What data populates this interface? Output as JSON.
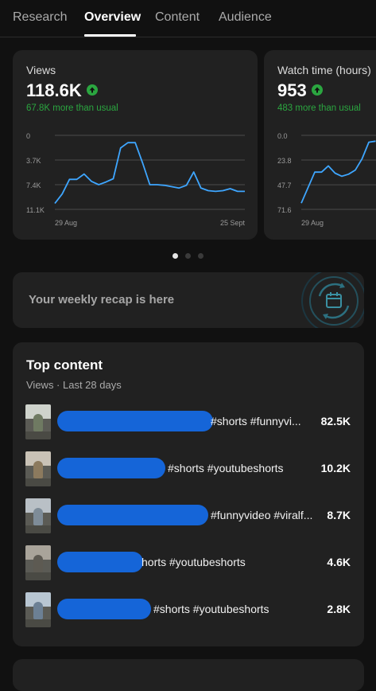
{
  "tabs": [
    "Research",
    "Overview",
    "Content",
    "Audience"
  ],
  "active_tab": "Overview",
  "metrics": [
    {
      "title": "Views",
      "value": "118.6K",
      "delta": "67.8K more than usual",
      "y_ticks": [
        "11.1K",
        "7.4K",
        "3.7K",
        "0"
      ],
      "x_labels": [
        "29 Aug",
        "25 Sept"
      ]
    },
    {
      "title": "Watch time (hours)",
      "value": "953",
      "delta": "483 more than usual",
      "y_ticks": [
        "71.6",
        "47.7",
        "23.8",
        "0.0"
      ],
      "x_labels": [
        "29 Aug"
      ]
    }
  ],
  "chart_data": [
    {
      "type": "line",
      "title": "Views",
      "ylim": [
        0,
        11100
      ],
      "y_ticks": [
        0,
        3700,
        7400,
        11100
      ],
      "x_range": [
        "29 Aug",
        "25 Sept"
      ],
      "series": [
        {
          "values": [
            900,
            2300,
            4500,
            4500,
            5300,
            4200,
            3700,
            4100,
            4600,
            9200,
            10000,
            10000,
            7000,
            3700,
            3700,
            3600,
            3400,
            3200,
            3600,
            5600,
            3200,
            2800,
            2700,
            2800,
            3100,
            2700,
            2700
          ]
        }
      ],
      "color": "#3ea6ff"
    },
    {
      "type": "line",
      "title": "Watch time (hours)",
      "ylim": [
        0,
        71.6
      ],
      "y_ticks": [
        0,
        23.8,
        47.7,
        71.6
      ],
      "x_range": [
        "29 Aug"
      ],
      "series": [
        {
          "values": [
            6,
            21,
            36,
            36,
            42,
            35,
            32,
            34,
            38,
            49,
            65,
            66
          ]
        }
      ],
      "color": "#3ea6ff"
    }
  ],
  "pager": {
    "count": 3,
    "active": 0
  },
  "recap": {
    "text": "Your weekly recap is here",
    "icon": "calendar-refresh-icon"
  },
  "top_content": {
    "title": "Top content",
    "subtitle": "Views · Last 28 days",
    "items": [
      {
        "title_visible": "#shorts #funnyvi...",
        "views": "82.5K"
      },
      {
        "title_visible": "#shorts #youtubeshorts",
        "views": "10.2K"
      },
      {
        "title_visible": "#funnyvideo #viralf...",
        "views": "8.7K"
      },
      {
        "title_visible": "horts #youtubeshorts",
        "views": "4.6K"
      },
      {
        "title_visible": "#shorts #youtubeshorts",
        "views": "2.8K"
      }
    ]
  },
  "colors": {
    "accent_line": "#3ea6ff",
    "positive": "#2ba640",
    "redaction": "#1565d8"
  }
}
